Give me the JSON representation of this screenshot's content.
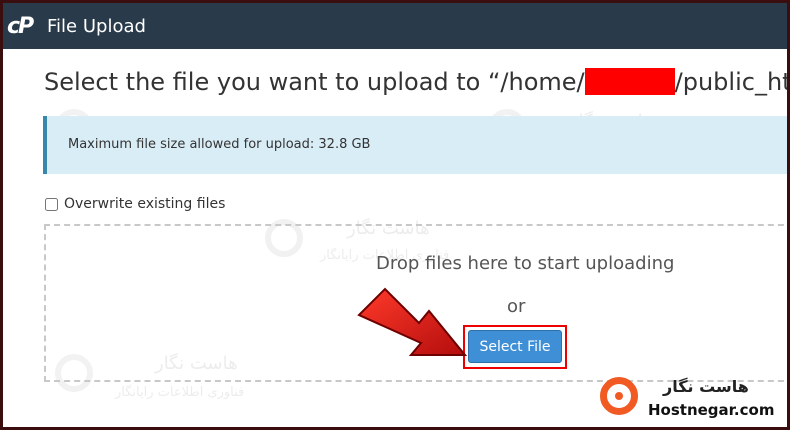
{
  "header": {
    "logo_text": "cP",
    "title": "File Upload"
  },
  "main": {
    "title_prefix": "Select the file you want to upload to “/home/",
    "title_suffix": "/public_html”.",
    "info_text": "Maximum file size allowed for upload: 32.8 GB",
    "overwrite_label": "Overwrite existing files",
    "overwrite_checked": false,
    "drop_text": "Drop files here to start uploading",
    "or_text": "or",
    "select_file_label": "Select File"
  },
  "watermark": {
    "line1": "هاست نگار",
    "line2": "فناوری اطلاعات رایانگار"
  },
  "brand": {
    "name_fa": "هاست نگار",
    "name_en": "Hostnegar.com",
    "accent_color": "#f15a22"
  },
  "colors": {
    "header_bg": "#293a4a",
    "info_bg": "#d9edf7",
    "button_bg": "#3f8fd6",
    "highlight": "#ee0000",
    "redaction": "#ff0000"
  }
}
